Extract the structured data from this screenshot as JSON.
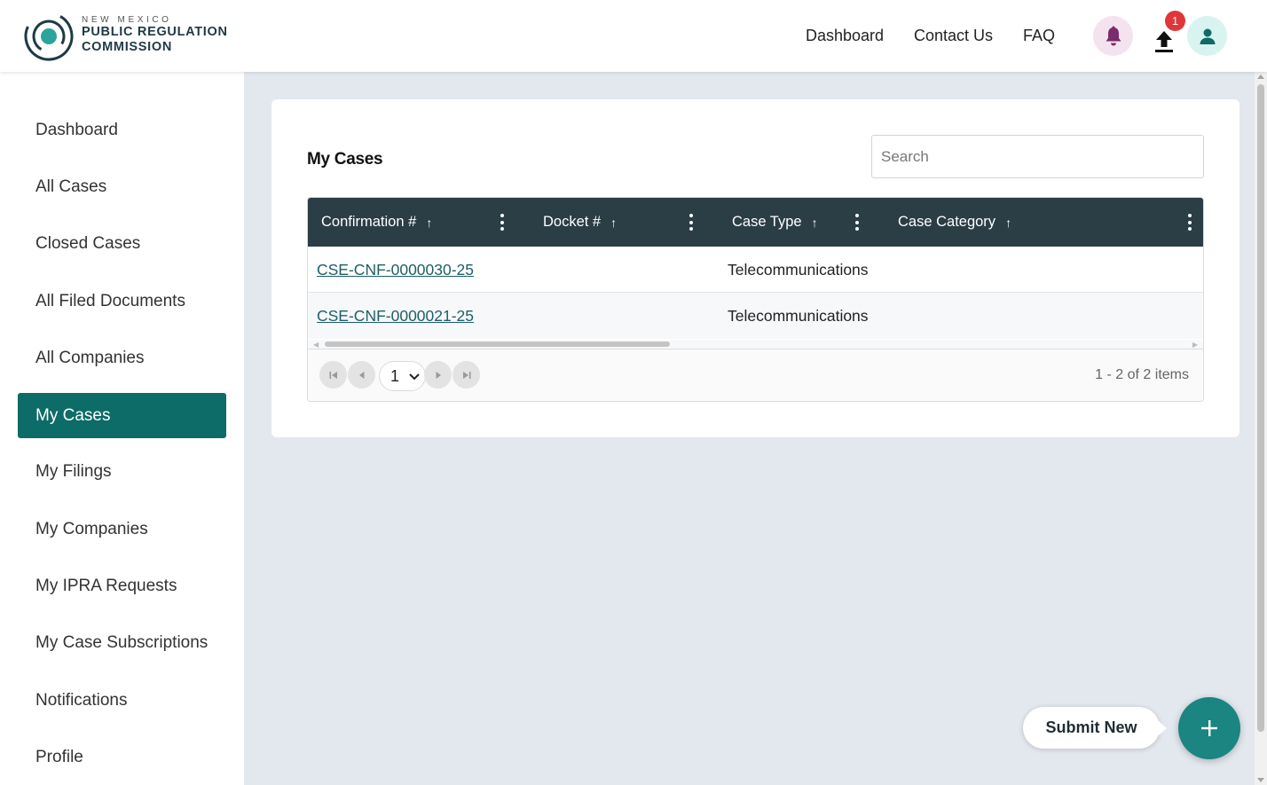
{
  "brand": {
    "line1": "NEW MEXICO",
    "line2": "PUBLIC REGULATION",
    "line3": "COMMISSION",
    "colors": {
      "primary": "#0d6b68",
      "dark": "#2b3d45",
      "accent": "#1a8581"
    }
  },
  "header": {
    "nav": [
      "Dashboard",
      "Contact Us",
      "FAQ"
    ],
    "upload_badge": "1",
    "icons": [
      "bell-icon",
      "upload-icon",
      "user-icon"
    ]
  },
  "sidebar": {
    "items": [
      {
        "label": "Dashboard"
      },
      {
        "label": "All Cases"
      },
      {
        "label": "Closed Cases"
      },
      {
        "label": "All Filed Documents"
      },
      {
        "label": "All Companies"
      },
      {
        "label": "My Cases",
        "active": true
      },
      {
        "label": "My Filings"
      },
      {
        "label": "My Companies"
      },
      {
        "label": "My IPRA Requests"
      },
      {
        "label": "My Case Subscriptions"
      },
      {
        "label": "Notifications"
      },
      {
        "label": "Profile"
      }
    ]
  },
  "main": {
    "title": "My Cases",
    "search": {
      "placeholder": "Search",
      "value": ""
    },
    "table": {
      "columns": [
        "Confirmation #",
        "Docket #",
        "Case Type",
        "Case Category"
      ],
      "rows": [
        {
          "confirmation": "CSE-CNF-0000030-25",
          "docket": "",
          "case_type": "Telecommunications",
          "case_category": ""
        },
        {
          "confirmation": "CSE-CNF-0000021-25",
          "docket": "",
          "case_type": "Telecommunications",
          "case_category": ""
        }
      ]
    },
    "pager": {
      "page": "1",
      "info": "1 - 2 of 2 items"
    }
  },
  "fab": {
    "label": "Submit New",
    "icon": "plus-icon"
  }
}
